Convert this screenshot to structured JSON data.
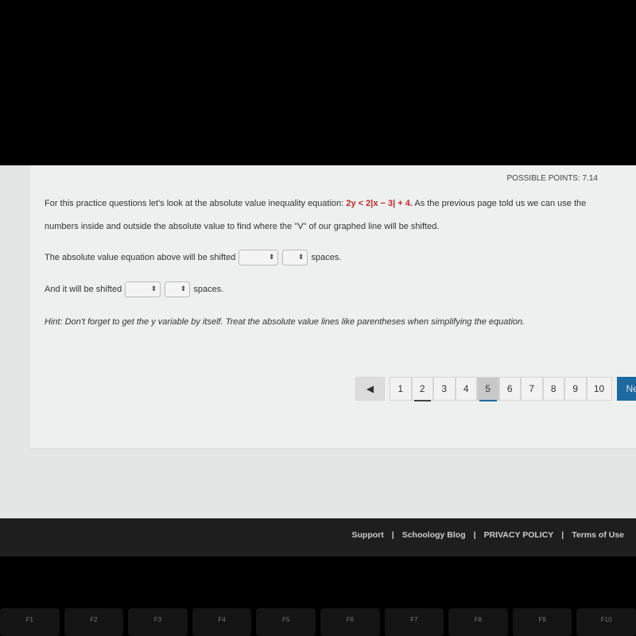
{
  "question": {
    "possible_points": "POSSIBLE POINTS: 7.14",
    "intro_before": "For this practice questions let's look at the absolute value inequality equation:",
    "equation": "2y < 2|x − 3| + 4.",
    "intro_after": "As the previous page told us we can use the",
    "intro_line2": "numbers inside and outside the absolute value to find where the \"V\" of our graphed line will be shifted.",
    "line1": "The absolute value equation above will be shifted",
    "line2": "And it will be shifted",
    "spaces": "spaces.",
    "hint": "Hint: Don't forget to get the y variable by itself. Treat the absolute value lines like parentheses when simplifying the equation."
  },
  "pager": {
    "prev": "◀",
    "pages": [
      "1",
      "2",
      "3",
      "4",
      "5",
      "6",
      "7",
      "8",
      "9",
      "10"
    ],
    "current": "5",
    "next": "Next"
  },
  "footer": {
    "links": [
      "Support",
      "Schoology Blog",
      "PRIVACY POLICY",
      "Terms of Use"
    ],
    "sep": "|"
  },
  "keyboard": [
    "F1",
    "F2",
    "F3",
    "F4",
    "F5",
    "F6",
    "F7",
    "F8",
    "F9",
    "F10"
  ]
}
